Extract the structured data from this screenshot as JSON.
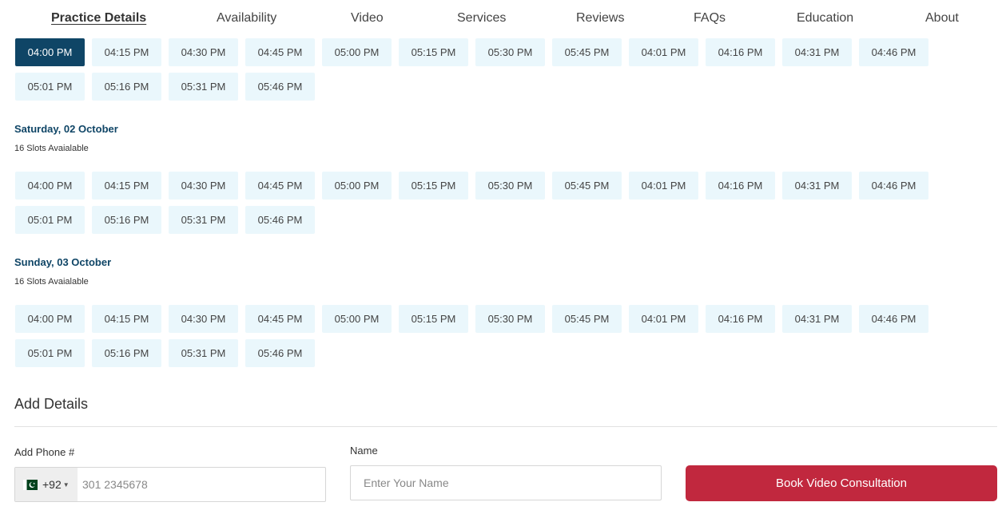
{
  "nav": {
    "items": [
      {
        "label": "Practice Details",
        "active": true
      },
      {
        "label": "Availability",
        "active": false
      },
      {
        "label": "Video",
        "active": false
      },
      {
        "label": "Services",
        "active": false
      },
      {
        "label": "Reviews",
        "active": false
      },
      {
        "label": "FAQs",
        "active": false
      },
      {
        "label": "Education",
        "active": false
      },
      {
        "label": "About",
        "active": false
      }
    ]
  },
  "days": [
    {
      "title": "",
      "count": "",
      "selected_slot": "04:00 PM",
      "slots": [
        "04:00 PM",
        "04:15 PM",
        "04:30 PM",
        "04:45 PM",
        "05:00 PM",
        "05:15 PM",
        "05:30 PM",
        "05:45 PM",
        "04:01 PM",
        "04:16 PM",
        "04:31 PM",
        "04:46 PM",
        "05:01 PM",
        "05:16 PM",
        "05:31 PM",
        "05:46 PM"
      ]
    },
    {
      "title": "Saturday, 02 October",
      "count": "16 Slots Avaialable",
      "slots": [
        "04:00 PM",
        "04:15 PM",
        "04:30 PM",
        "04:45 PM",
        "05:00 PM",
        "05:15 PM",
        "05:30 PM",
        "05:45 PM",
        "04:01 PM",
        "04:16 PM",
        "04:31 PM",
        "04:46 PM",
        "05:01 PM",
        "05:16 PM",
        "05:31 PM",
        "05:46 PM"
      ]
    },
    {
      "title": "Sunday, 03 October",
      "count": "16 Slots Avaialable",
      "slots": [
        "04:00 PM",
        "04:15 PM",
        "04:30 PM",
        "04:45 PM",
        "05:00 PM",
        "05:15 PM",
        "05:30 PM",
        "05:45 PM",
        "04:01 PM",
        "04:16 PM",
        "04:31 PM",
        "04:46 PM",
        "05:01 PM",
        "05:16 PM",
        "05:31 PM",
        "05:46 PM"
      ]
    }
  ],
  "details": {
    "title": "Add Details",
    "phone_label": "Add Phone #",
    "country_code": "+92",
    "country_flag_icon": "pakistan-flag-icon",
    "phone_placeholder": "301 2345678",
    "name_label": "Name",
    "name_placeholder": "Enter Your Name",
    "book_button": "Book Video Consultation"
  },
  "colors": {
    "primary": "#0f4566",
    "slot_bg": "#eaf7fc",
    "book_button": "#c1283e",
    "flag_green": "#01411c"
  }
}
